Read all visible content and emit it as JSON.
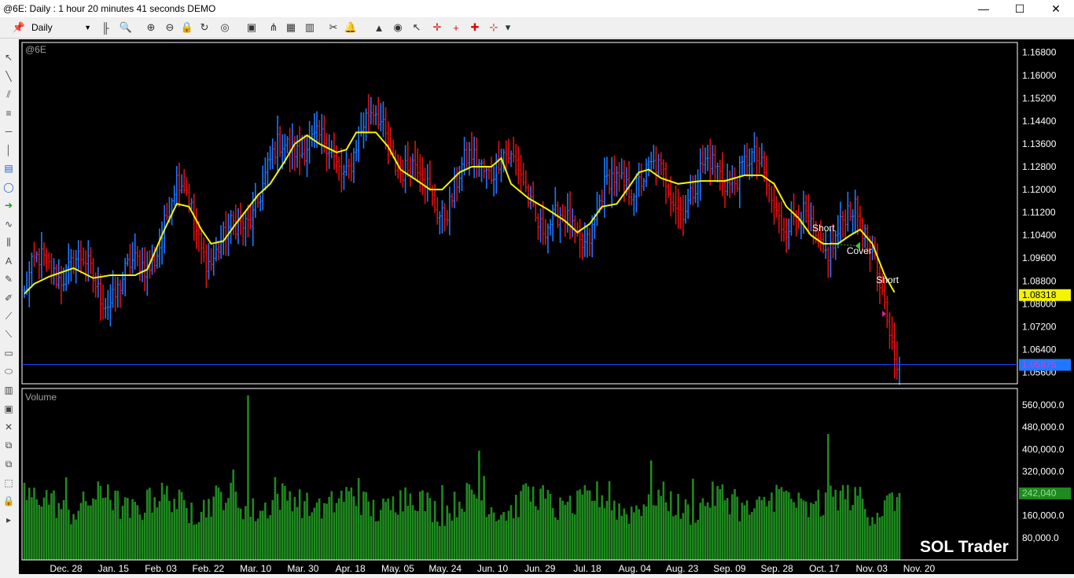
{
  "window": {
    "title": "@6E: Daily : 1 hour 20 minutes 41 seconds DEMO",
    "minimize": "—",
    "maximize": "☐",
    "close": "✕"
  },
  "toolbar": {
    "interval": "Daily",
    "icons": [
      "pin-icon",
      "bar-style-icon",
      "zoom-icon",
      "zoom-in-icon",
      "zoom-out-icon",
      "lock-icon",
      "refresh-icon",
      "link-icon",
      "indicator-icon",
      "network-icon",
      "color-icon",
      "bars-icon",
      "scissors-icon",
      "bell-icon",
      "cube-icon",
      "mouse-icon",
      "pointer-icon",
      "crosshair-icon",
      "crosshair-plus-icon",
      "crosshair-dot-icon",
      "crosshair-arrow-icon",
      "more-icon"
    ]
  },
  "sidebar": {
    "icons": [
      "arrow-tool-icon",
      "line-tool-icon",
      "trend-tool-icon",
      "channel-tool-icon",
      "hline-tool-icon",
      "vline-tool-icon",
      "note-tool-icon",
      "callout-tool-icon",
      "arrow-right-tool-icon",
      "wave-tool-icon",
      "fib-tool-icon",
      "text-tool-icon",
      "pen-tool-icon",
      "brush-tool-icon",
      "fan-tool-icon",
      "gann-tool-icon",
      "rectangle-tool-icon",
      "ellipse-tool-icon",
      "layers-icon",
      "image-icon",
      "delete-icon",
      "copy-icon",
      "paste-icon",
      "select-icon",
      "padlock-icon",
      "expand-icon"
    ]
  },
  "chart_data": [
    {
      "type": "bar",
      "subtype": "ohlc",
      "symbol": "@6E",
      "ylim": [
        1.052,
        1.1715
      ],
      "y_ticks": [
        "1.16800",
        "1.16000",
        "1.15200",
        "1.14400",
        "1.13600",
        "1.12800",
        "1.12000",
        "1.11200",
        "1.10400",
        "1.09600",
        "1.08800",
        "1.08000",
        "1.07200",
        "1.06400",
        "1.05600"
      ],
      "x_labels": [
        "Dec. 28",
        "Jan. 15",
        "Feb. 03",
        "Feb. 22",
        "Mar. 10",
        "Mar. 30",
        "Apr. 18",
        "May. 05",
        "May. 24",
        "Jun. 10",
        "Jun. 29",
        "Jul. 18",
        "Aug. 04",
        "Aug. 23",
        "Sep. 09",
        "Sep. 28",
        "Oct. 17",
        "Nov. 03",
        "Nov. 20"
      ],
      "series": [
        {
          "name": "moving-average",
          "color": "#f4f400",
          "points": [
            [
              0,
              1.0835
            ],
            [
              4,
              1.087
            ],
            [
              10,
              1.0895
            ],
            [
              20,
              1.0925
            ],
            [
              28,
              1.089
            ],
            [
              35,
              1.09
            ],
            [
              45,
              1.09
            ],
            [
              50,
              1.092
            ],
            [
              57,
              1.106
            ],
            [
              62,
              1.115
            ],
            [
              67,
              1.114
            ],
            [
              72,
              1.106
            ],
            [
              76,
              1.101
            ],
            [
              81,
              1.102
            ],
            [
              86,
              1.108
            ],
            [
              95,
              1.118
            ],
            [
              100,
              1.122
            ],
            [
              106,
              1.13
            ],
            [
              110,
              1.136
            ],
            [
              115,
              1.139
            ],
            [
              120,
              1.136
            ],
            [
              127,
              1.133
            ],
            [
              131,
              1.134
            ],
            [
              135,
              1.14
            ],
            [
              143,
              1.14
            ],
            [
              148,
              1.135
            ],
            [
              153,
              1.127
            ],
            [
              160,
              1.123
            ],
            [
              165,
              1.12
            ],
            [
              170,
              1.12
            ],
            [
              177,
              1.126
            ],
            [
              182,
              1.128
            ],
            [
              190,
              1.128
            ],
            [
              194,
              1.131
            ],
            [
              198,
              1.122
            ],
            [
              205,
              1.117
            ],
            [
              213,
              1.113
            ],
            [
              220,
              1.109
            ],
            [
              225,
              1.105
            ],
            [
              230,
              1.108
            ],
            [
              235,
              1.114
            ],
            [
              241,
              1.115
            ],
            [
              246,
              1.121
            ],
            [
              250,
              1.126
            ],
            [
              254,
              1.127
            ],
            [
              259,
              1.124
            ],
            [
              266,
              1.122
            ],
            [
              275,
              1.123
            ],
            [
              285,
              1.123
            ],
            [
              293,
              1.125
            ],
            [
              300,
              1.125
            ],
            [
              305,
              1.122
            ],
            [
              310,
              1.114
            ],
            [
              315,
              1.11
            ],
            [
              320,
              1.104
            ],
            [
              325,
              1.101
            ],
            [
              331,
              1.101
            ],
            [
              336,
              1.104
            ],
            [
              340,
              1.106
            ],
            [
              345,
              1.101
            ],
            [
              350,
              1.09
            ],
            [
              354,
              1.084
            ]
          ]
        },
        {
          "name": "bars",
          "up_color": "#1e78ff",
          "down_color": "#e01010"
        }
      ],
      "last_price": "1.05875",
      "last_price_value": 1.05875,
      "ma_value": "1.08318",
      "ma_value_num": 1.08318,
      "annotations": [
        {
          "label": "Short",
          "x": 325,
          "y": 1.1065
        },
        {
          "label": "Cover",
          "x": 339,
          "y": 1.0985
        },
        {
          "label": "Short",
          "x": 351,
          "y": 1.0883
        }
      ],
      "watermark": "SOL Trader"
    },
    {
      "type": "bar",
      "name": "Volume",
      "ylim": [
        0,
        620000
      ],
      "y_ticks": [
        "560,000.0",
        "480,000.0",
        "400,000.0",
        "320,000.0",
        "240,000.0",
        "160,000.0",
        "80,000.0"
      ],
      "last_value": "242,040",
      "last_value_num": 242040,
      "color": "#1f8a1f"
    }
  ]
}
